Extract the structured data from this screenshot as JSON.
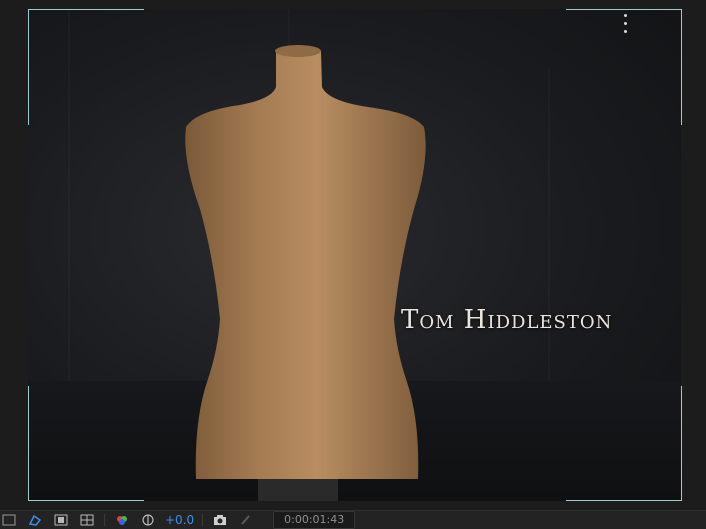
{
  "composition": {
    "title_text": "Tom Hiddleston"
  },
  "toolbar": {
    "exposure_value": "+0.0",
    "timecode": "0:00:01:43"
  },
  "colors": {
    "frame_guides": "#9ecbd0",
    "exposure_accent": "#3b8fe8"
  },
  "icons": {
    "mask_toggle": "mask-path-icon",
    "region": "region-of-interest-icon",
    "grid": "grid-guides-icon",
    "channels": "rgb-channels-icon",
    "exposure": "exposure-icon",
    "snapshot": "camera-icon",
    "show_snapshot": "show-snapshot-icon"
  }
}
